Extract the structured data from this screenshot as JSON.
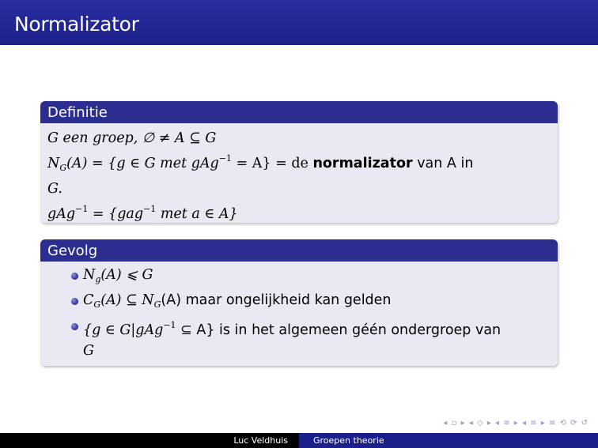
{
  "slide": {
    "title": "Normalizator"
  },
  "definitie": {
    "header": "Definitie",
    "line1": "G een groep, ∅ ≠ A ⊆ G",
    "line2_prefix": "N",
    "line2_sub": "G",
    "line2_a": "(A) = {g ∈ G met gAg",
    "line2_sup": "−1",
    "line2_b": " = A} = de ",
    "line2_bold": "normalizator",
    "line2_c": " van A in",
    "line3": "G.",
    "line4_a": "gAg",
    "line4_sup1": "−1",
    "line4_b": " = {gag",
    "line4_sup2": "−1",
    "line4_c": " met a ∈ A}"
  },
  "gevolg": {
    "header": "Gevolg",
    "item1": {
      "a": "N",
      "sub": "g",
      "b": "(A) ⩽ G"
    },
    "item2": {
      "a": "C",
      "sub1": "G",
      "b": "(A) ⊆ N",
      "sub2": "G",
      "c": "(A) maar ongelijkheid kan gelden"
    },
    "item3": {
      "a": "{g ∈ G|gAg",
      "sup": "−1",
      "b": " ⊆ A} is in het algemeen géén ondergroep van",
      "c": "G"
    }
  },
  "nav": {
    "symbols": "◂ ▫ ▸ ◂ ◇ ▸ ◂ ≡ ▸ ◂ ≡ ▸   ≡   ⟲ ⟳ ↺"
  },
  "footer": {
    "author": "Luc Veldhuis",
    "course": "Groepen theorie"
  },
  "colors": {
    "title_bg": "#1c1f8a",
    "block_head": "#2b2e8f",
    "block_body": "#e9e9f3"
  }
}
